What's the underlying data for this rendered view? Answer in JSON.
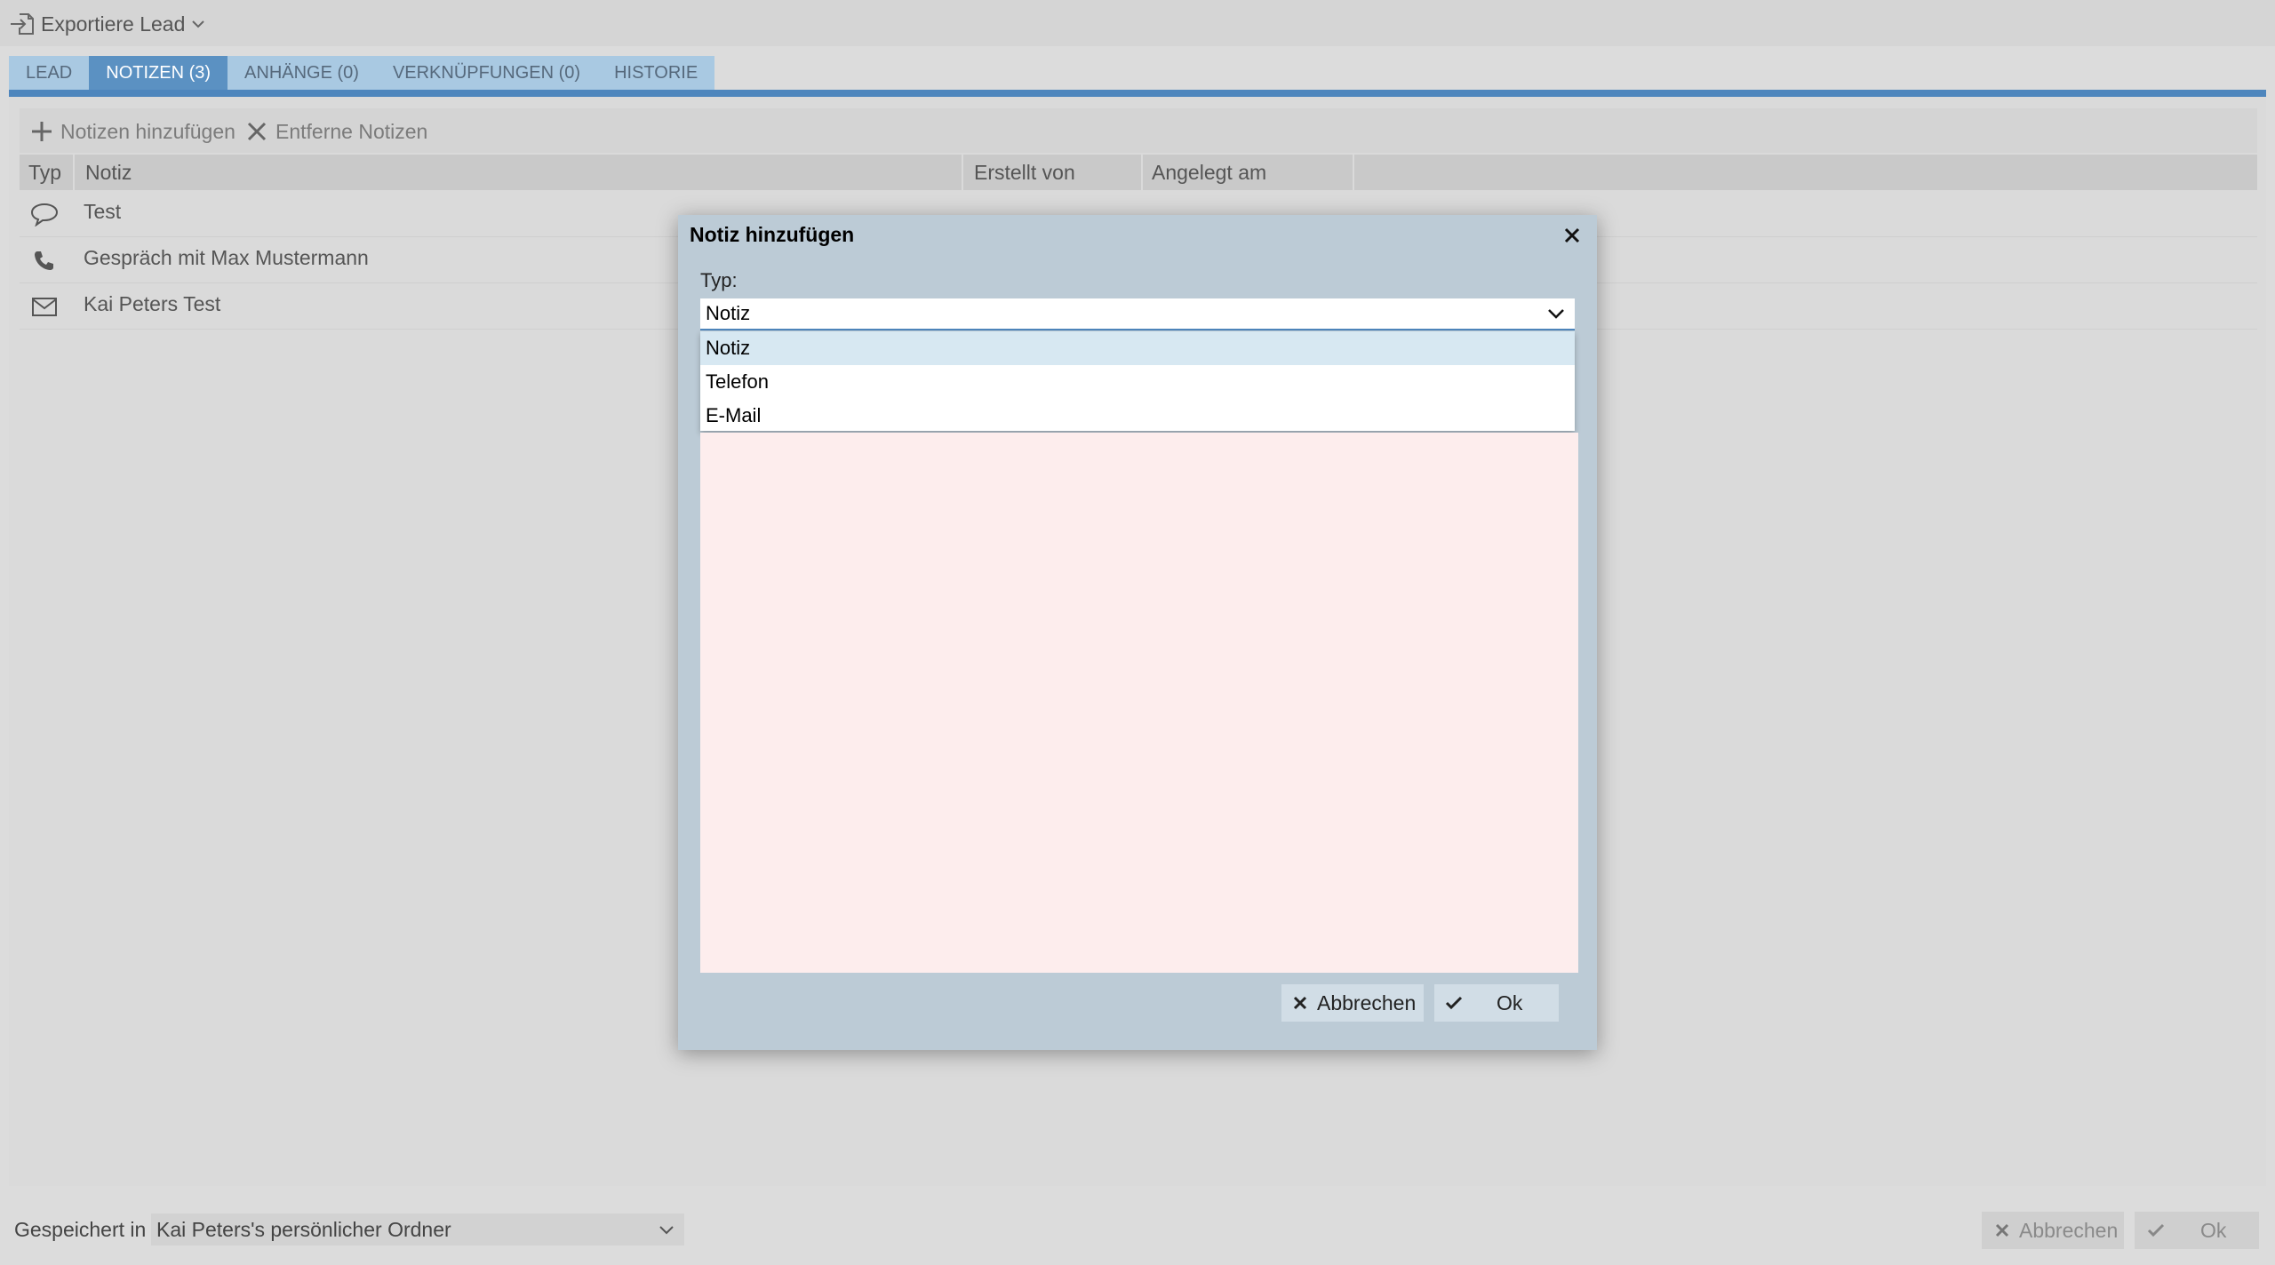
{
  "topbar": {
    "export_label": "Exportiere Lead",
    "export_icon": "export-icon"
  },
  "tabs": [
    {
      "label": "LEAD",
      "active": false
    },
    {
      "label": "NOTIZEN (3)",
      "active": true
    },
    {
      "label": "ANHÄNGE (0)",
      "active": false
    },
    {
      "label": "VERKNÜPFUNGEN (0)",
      "active": false
    },
    {
      "label": "HISTORIE",
      "active": false
    }
  ],
  "toolbar": {
    "add_label": "Notizen hinzufügen",
    "remove_label": "Entferne Notizen"
  },
  "table": {
    "columns": [
      "Typ",
      "Notiz",
      "Erstellt von",
      "Angelegt am"
    ],
    "rows": [
      {
        "type_icon": "speech-bubble-icon",
        "note": "Test"
      },
      {
        "type_icon": "phone-icon",
        "note": "Gespräch mit Max Mustermann"
      },
      {
        "type_icon": "envelope-icon",
        "note": "Kai Peters Test"
      }
    ]
  },
  "footer": {
    "saved_in_label": "Gespeichert in",
    "folder_value": "Kai Peters's persönlicher Ordner",
    "cancel_label": "Abbrechen",
    "ok_label": "Ok"
  },
  "modal": {
    "title": "Notiz hinzufügen",
    "type_label": "Typ:",
    "type_value": "Notiz",
    "options": [
      "Notiz",
      "Telefon",
      "E-Mail"
    ],
    "selected_option": "Notiz",
    "cancel_label": "Abbrechen",
    "ok_label": "Ok"
  },
  "colors": {
    "accent": "#4e86bd",
    "tab_active": "#5b91c2",
    "tab_inactive": "#a9c9e2",
    "modal_bg": "#bccbd6",
    "note_area_bg": "#fdeded"
  }
}
